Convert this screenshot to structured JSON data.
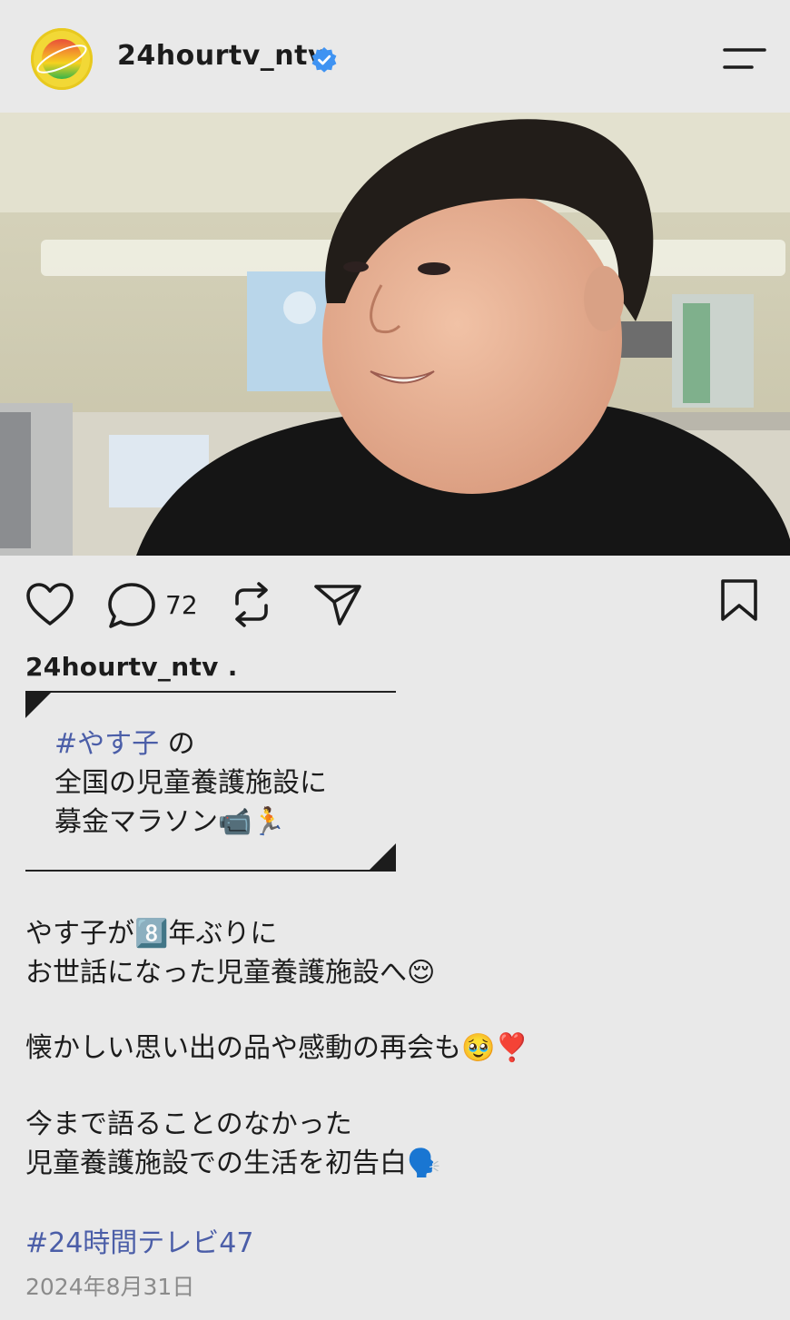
{
  "header": {
    "username": "24hourtv_ntv",
    "verified_icon": "verified-badge-icon",
    "menu_icon": "menu-icon"
  },
  "post": {
    "image_alt": "person-photo",
    "actions": {
      "like_icon": "heart-icon",
      "comment_icon": "comment-bubble-icon",
      "comment_count": "72",
      "repost_icon": "repost-icon",
      "share_icon": "send-icon",
      "save_icon": "bookmark-icon"
    },
    "caption_user": "24hourtv_ntv .",
    "quote": {
      "hashtag": "#やす子",
      "line1_rest": " の",
      "line2": "全国の児童養護施設に",
      "line3": "募金マラソン📹🏃"
    },
    "body": {
      "p1_l1": "やす子が8️⃣年ぶりに",
      "p1_l2": "お世話になった児童養護施設へ😌",
      "p2_l1": "懐かしい思い出の品や感動の再会も🥹❣️",
      "p3_l1": "今まで語ることのなかった",
      "p3_l2": "児童養護施設での生活を初告白🗣️"
    },
    "hashtag": "#24時間テレビ47",
    "date": "2024年8月31日"
  },
  "colors": {
    "background": "#e9e9e9",
    "link": "#4b5ea8",
    "verified": "#3f93f2",
    "date": "#8b8b8b"
  }
}
